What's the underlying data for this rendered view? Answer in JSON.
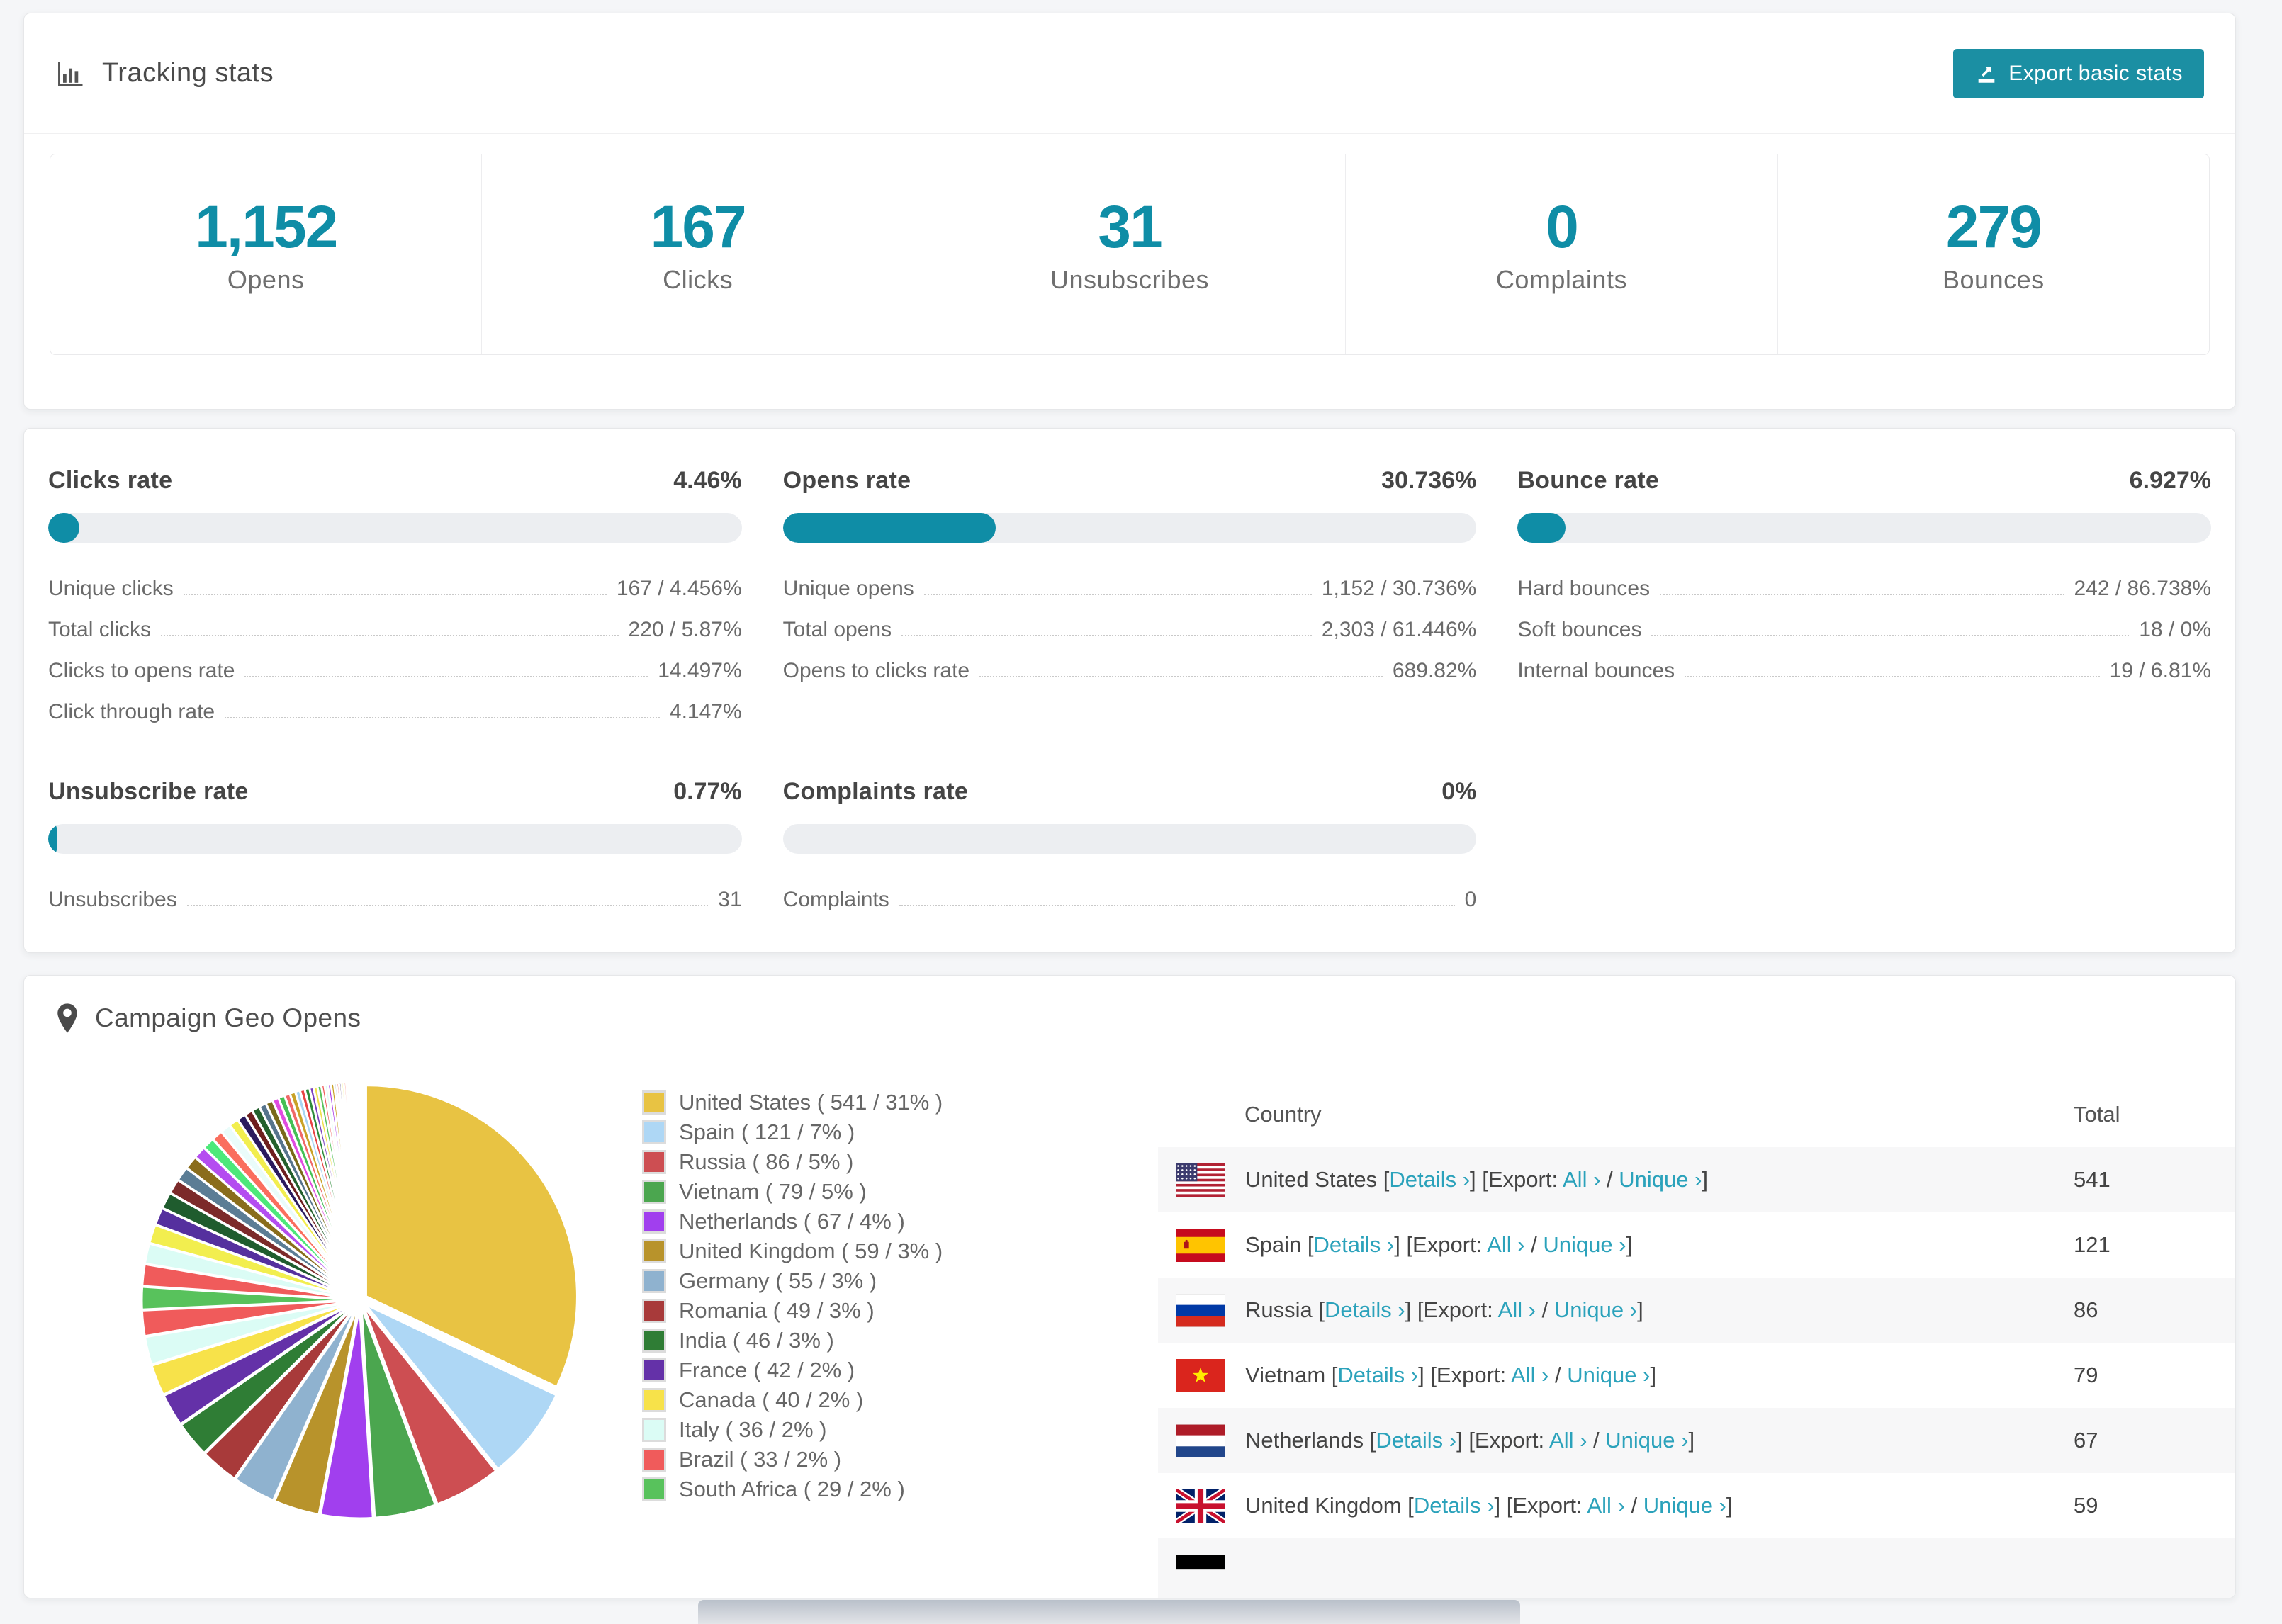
{
  "accent": "#0f8da6",
  "link_color": "#2ba2bb",
  "tracking": {
    "title": "Tracking stats",
    "export_label": "Export basic stats",
    "stats": [
      {
        "value": "1,152",
        "label": "Opens"
      },
      {
        "value": "167",
        "label": "Clicks"
      },
      {
        "value": "31",
        "label": "Unsubscribes"
      },
      {
        "value": "0",
        "label": "Complaints"
      },
      {
        "value": "279",
        "label": "Bounces"
      }
    ]
  },
  "rates": [
    {
      "title": "Clicks rate",
      "value": "4.46%",
      "percent": 4.46,
      "rows": [
        {
          "label": "Unique clicks",
          "value": "167 / 4.456%"
        },
        {
          "label": "Total clicks",
          "value": "220 / 5.87%"
        },
        {
          "label": "Clicks to opens rate",
          "value": "14.497%"
        },
        {
          "label": "Click through rate",
          "value": "4.147%"
        }
      ]
    },
    {
      "title": "Opens rate",
      "value": "30.736%",
      "percent": 30.736,
      "rows": [
        {
          "label": "Unique opens",
          "value": "1,152 / 30.736%"
        },
        {
          "label": "Total opens",
          "value": "2,303 / 61.446%"
        },
        {
          "label": "Opens to clicks rate",
          "value": "689.82%"
        }
      ]
    },
    {
      "title": "Bounce rate",
      "value": "6.927%",
      "percent": 6.927,
      "rows": [
        {
          "label": "Hard bounces",
          "value": "242 / 86.738%"
        },
        {
          "label": "Soft bounces",
          "value": "18 / 0%"
        },
        {
          "label": "Internal bounces",
          "value": "19 / 6.81%"
        }
      ]
    },
    {
      "title": "Unsubscribe rate",
      "value": "0.77%",
      "percent": 0.77,
      "rows": [
        {
          "label": "Unsubscribes",
          "value": "31"
        }
      ]
    },
    {
      "title": "Complaints rate",
      "value": "0%",
      "percent": 0,
      "rows": [
        {
          "label": "Complaints",
          "value": "0"
        }
      ]
    }
  ],
  "geo": {
    "title": "Campaign Geo Opens",
    "table": {
      "headers": [
        "Country",
        "Total"
      ],
      "link_labels": {
        "details": "Details ›",
        "export_prefix": "[Export:",
        "all": "All ›",
        "unique": "Unique ›"
      },
      "rows": [
        {
          "country": "United States",
          "total": "541",
          "flag": "us"
        },
        {
          "country": "Spain",
          "total": "121",
          "flag": "es"
        },
        {
          "country": "Russia",
          "total": "86",
          "flag": "ru"
        },
        {
          "country": "Vietnam",
          "total": "79",
          "flag": "vn"
        },
        {
          "country": "Netherlands",
          "total": "67",
          "flag": "nl"
        },
        {
          "country": "United Kingdom",
          "total": "59",
          "flag": "gb"
        }
      ],
      "partial_row_flag": "de"
    }
  },
  "chart_data": {
    "type": "pie",
    "title": "Campaign Geo Opens",
    "legend_position": "right",
    "categories": [
      "United States",
      "Spain",
      "Russia",
      "Vietnam",
      "Netherlands",
      "United Kingdom",
      "Germany",
      "Romania",
      "India",
      "France",
      "Canada",
      "Italy",
      "Brazil",
      "South Africa"
    ],
    "values": [
      541,
      121,
      86,
      79,
      67,
      59,
      55,
      49,
      46,
      42,
      40,
      36,
      33,
      29
    ],
    "legend_labels": [
      "United States ( 541 / 31% )",
      "Spain ( 121 / 7% )",
      "Russia ( 86 / 5% )",
      "Vietnam ( 79 / 5% )",
      "Netherlands ( 67 / 4% )",
      "United Kingdom ( 59 / 3% )",
      "Germany ( 55 / 3% )",
      "Romania ( 49 / 3% )",
      "India ( 46 / 3% )",
      "France ( 42 / 2% )",
      "Canada ( 40 / 2% )",
      "Italy ( 36 / 2% )",
      "Brazil ( 33 / 2% )",
      "South Africa ( 29 / 2% )"
    ],
    "colors": [
      "#e8c343",
      "#aed7f5",
      "#cd4e52",
      "#4ba64f",
      "#a13fee",
      "#b8932b",
      "#8fb2cf",
      "#a83a3a",
      "#2f7d35",
      "#6431a8",
      "#f7e24a",
      "#dbfcf5",
      "#f05b5b",
      "#58c25c"
    ],
    "tail_values": [
      28,
      26,
      24,
      22,
      21,
      19,
      18,
      17,
      16,
      15,
      14,
      13,
      12,
      11,
      10,
      10,
      9,
      9,
      8,
      8,
      7,
      7,
      6,
      6,
      6,
      5,
      5,
      5,
      4,
      4,
      4,
      4,
      3,
      3,
      3,
      3,
      3,
      2,
      2,
      2,
      2,
      2,
      2,
      1,
      1,
      1,
      1,
      1
    ],
    "tail_colors": [
      "#f05b5b",
      "#dbfcf5",
      "#f2ee4f",
      "#55309e",
      "#1f5c2e",
      "#7c2a2a",
      "#5b7d95",
      "#8a6d1c",
      "#b44df0",
      "#4de87a",
      "#fa6e5e",
      "#eafcfa",
      "#f2ee4f",
      "#2a1a5e",
      "#6e1e1e",
      "#24602c",
      "#56748c",
      "#7a6a1a",
      "#e04ce0",
      "#44c055",
      "#f06868",
      "#c9a227",
      "#a8d5f2",
      "#e84444",
      "#2e8b3a",
      "#7a3fbf",
      "#f0e04d",
      "#58c25c",
      "#f05b5b",
      "#dbfcf5",
      "#a838e8",
      "#c9a227",
      "#8ab0cc",
      "#e84444",
      "#2a1a5e",
      "#f5ef55",
      "#fa6e5e",
      "#4de87a",
      "#e04ce0",
      "#56748c",
      "#7c2a2a",
      "#1f5c2e",
      "#b44df0",
      "#f2ee4f",
      "#5b7d95",
      "#8a6d1c",
      "#44c055",
      "#f06868"
    ]
  }
}
